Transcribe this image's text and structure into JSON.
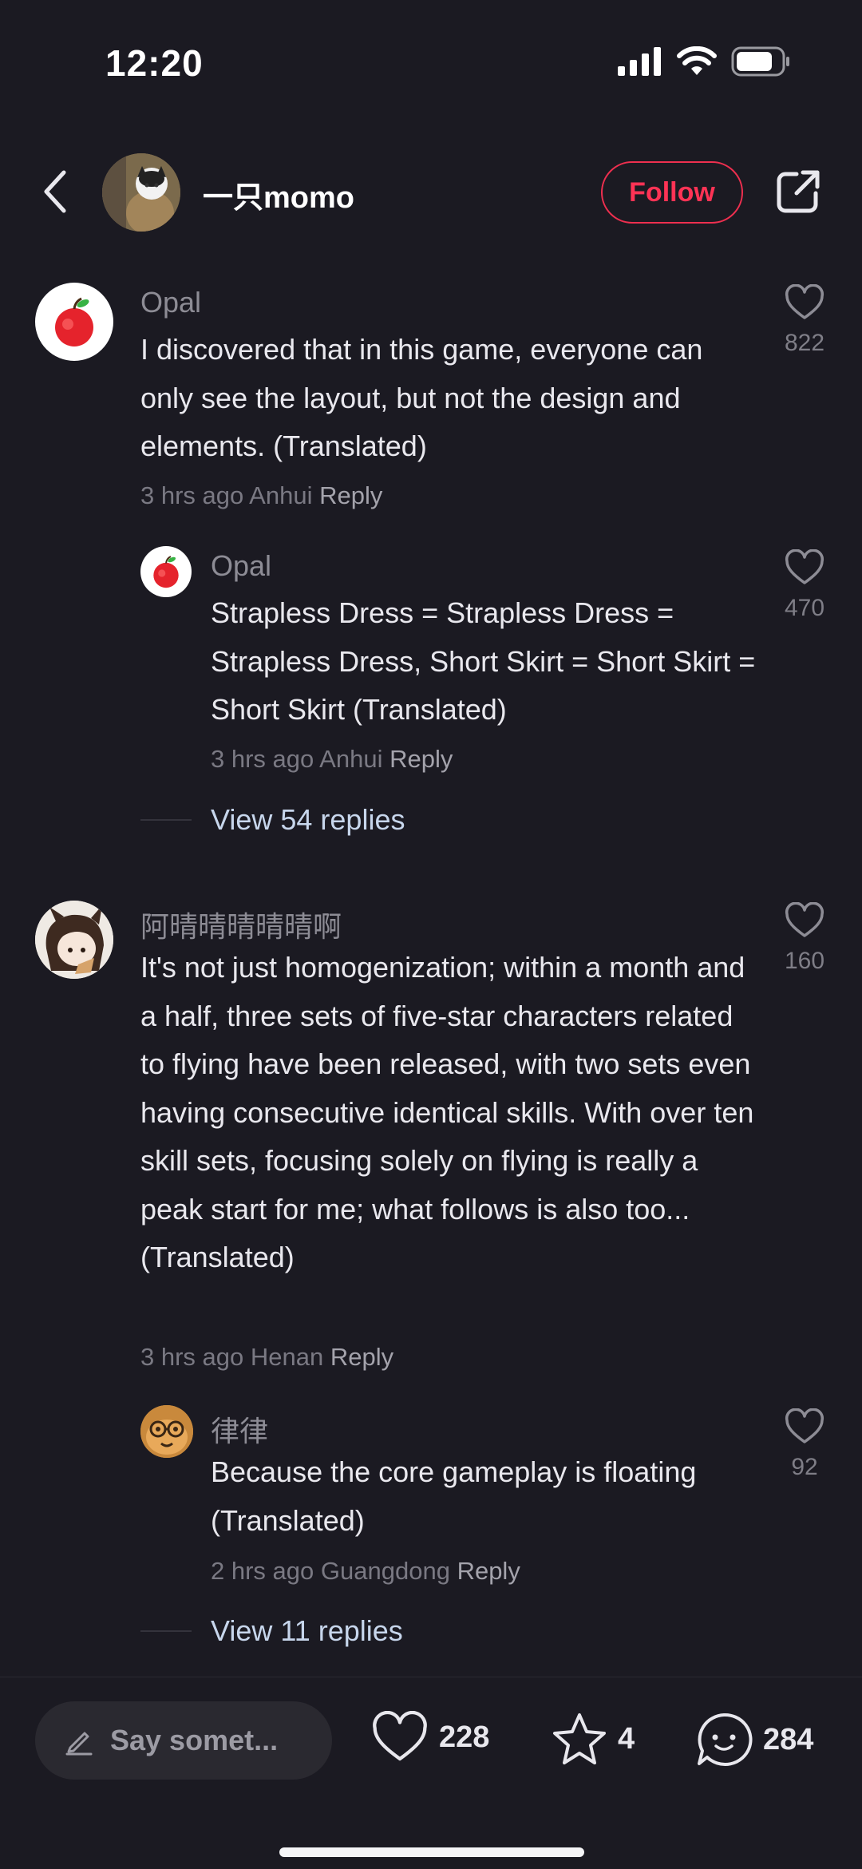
{
  "status_bar": {
    "time": "12:20"
  },
  "header": {
    "author_name": "一只momo",
    "follow_label": "Follow"
  },
  "comments": [
    {
      "username": "Opal",
      "text": "I discovered that in this game, everyone can only see the layout, but not the design and elements. (Translated)",
      "time": "3 hrs ago",
      "location": "Anhui",
      "reply_label": "Reply",
      "likes": "822",
      "replies": [
        {
          "username": "Opal",
          "text": "Strapless Dress = Strapless Dress = Strapless Dress, Short Skirt = Short Skirt = Short Skirt (Translated)",
          "time": "3 hrs ago",
          "location": "Anhui",
          "reply_label": "Reply",
          "likes": "470"
        }
      ],
      "view_replies": "View 54 replies"
    },
    {
      "username": "阿晴晴晴晴晴啊",
      "text": "It's not just homogenization; within a month and a half, three sets of five-star characters related to flying have been released, with two sets even having consecutive identical skills. With over ten skill sets, focusing solely on flying is really a peak start for me; what follows is also too... (Translated)",
      "time": "3 hrs ago",
      "location": "Henan",
      "reply_label": "Reply",
      "likes": "160",
      "replies": [
        {
          "username": "律律",
          "text": "Because the core gameplay is floating (Translated)",
          "time": "2 hrs ago",
          "location": "Guangdong",
          "reply_label": "Reply",
          "likes": "92"
        }
      ],
      "view_replies": "View 11 replies"
    }
  ],
  "bottom_bar": {
    "input_placeholder": "Say somet...",
    "likes": "228",
    "stars": "4",
    "comments": "284"
  },
  "colors": {
    "accent": "#ff3355",
    "background": "#1b1a22",
    "link": "#c7d6ec"
  }
}
